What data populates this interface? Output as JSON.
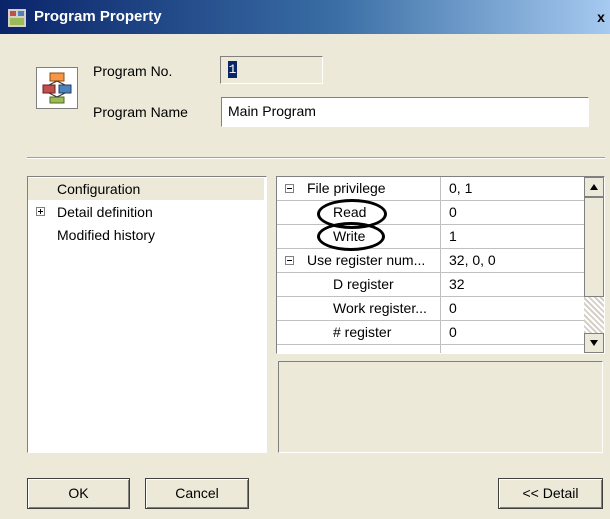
{
  "window": {
    "title": "Program Property",
    "close_label": "x"
  },
  "form": {
    "program_no_label": "Program No.",
    "program_no_value": "1",
    "program_name_label": "Program Name",
    "program_name_value": "Main Program"
  },
  "tree": {
    "items": [
      {
        "label": "Configuration",
        "selected": true,
        "expander": ""
      },
      {
        "label": "Detail definition",
        "selected": false,
        "expander": "plus"
      },
      {
        "label": "Modified history",
        "selected": false,
        "expander": ""
      }
    ]
  },
  "grid": {
    "rows": [
      {
        "name": "File privilege",
        "value": "0, 1",
        "expander": "minus",
        "indent": 0
      },
      {
        "name": "Read",
        "value": "0",
        "expander": "",
        "indent": 1
      },
      {
        "name": "Write",
        "value": "1",
        "expander": "",
        "indent": 1
      },
      {
        "name": "Use register num...",
        "value": "32, 0, 0",
        "expander": "minus",
        "indent": 0
      },
      {
        "name": "D register",
        "value": "32",
        "expander": "",
        "indent": 1
      },
      {
        "name": "Work register...",
        "value": "0",
        "expander": "",
        "indent": 1
      },
      {
        "name": "# register",
        "value": "0",
        "expander": "",
        "indent": 1
      }
    ]
  },
  "buttons": {
    "ok": "OK",
    "cancel": "Cancel",
    "detail": "<< Detail"
  },
  "icons": {
    "title": "program-property-icon",
    "program": "program-flowchart-icon",
    "scroll_up": "scroll-up-arrow-icon",
    "scroll_down": "scroll-down-arrow-icon"
  }
}
